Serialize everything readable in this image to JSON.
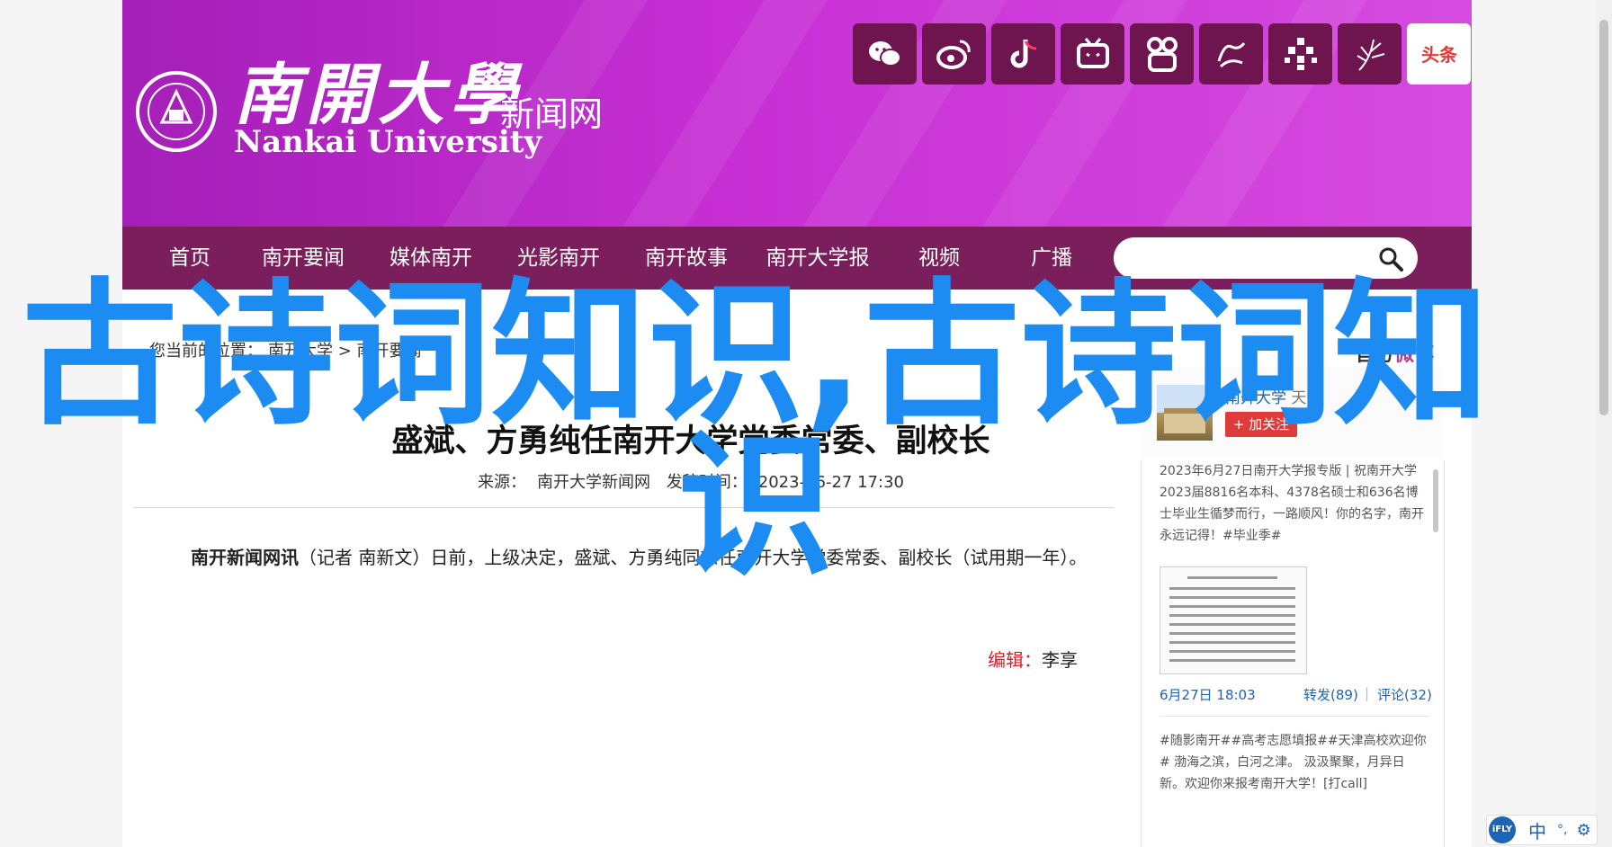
{
  "colors": {
    "banner_purple": "#c72fd4",
    "nav_purple": "#7a1f5b",
    "overlay_blue": "#1c8cf2",
    "link_blue": "#1d63b6",
    "editor_red": "#d0202a",
    "follow_red": "#e03b3b"
  },
  "header": {
    "logo_cn": "南開大學",
    "logo_en": "Nankai University",
    "logo_sub": "新闻网",
    "social_icons": [
      "wechat-icon",
      "weibo-icon",
      "douyin-icon",
      "bilibili-icon",
      "kuaishou-icon",
      "xuexi-icon",
      "dots-icon",
      "plant-icon",
      "toutiao-icon"
    ],
    "toutiao_label": "头条"
  },
  "nav": {
    "items": [
      "首页",
      "南开要闻",
      "媒体南开",
      "光影南开",
      "南开故事",
      "南开大学报",
      "视频",
      "广播"
    ],
    "search_placeholder": ""
  },
  "breadcrumb": {
    "label": "您当前的位置：",
    "trail": "南开大学 > 南开要闻"
  },
  "article": {
    "title": "盛斌、方勇纯任南开大学党委常委、副校长",
    "meta_source_label": "来源：",
    "meta_source": "南开大学新闻网",
    "meta_time_label": "发稿时间：",
    "meta_time": "2023-06-27 17:30",
    "body_lead": "南开新闻网讯",
    "body_text": "（记者 南新文）日前，上级决定，盛斌、方勇纯同志任南开大学党委常委、副校长（试用期一年）。",
    "editor_label": "编辑：",
    "editor_name": "李享"
  },
  "sidebar": {
    "heading_plain": "官方",
    "heading_accent": "微博",
    "profile_name": "南开大学",
    "profile_location": "天津",
    "follow_label": "+ 加关注",
    "post1": "2023年6月27日南开大学报专版 | 祝南开大学2023届8816名本科、4378名硕士和636名博士毕业生循梦而行，一路顺风！你的名字，南开永远记得！#毕业季#",
    "post1_time": "6月27日 18:03",
    "post1_reposts": "转发(89)",
    "post1_comments": "评论(32)",
    "separator": "|",
    "post2": "#随影南开##高考志愿填报##天津高校欢迎你# 渤海之滨，白河之津。 汲汲聚聚，月异日新。欢迎你来报考南开大学！[打call]"
  },
  "overlay": {
    "text": "古诗词知识,古诗词知识"
  },
  "ime": {
    "logo": "iFLY",
    "mode": "中",
    "dot": "°,",
    "gear": "⚙"
  }
}
